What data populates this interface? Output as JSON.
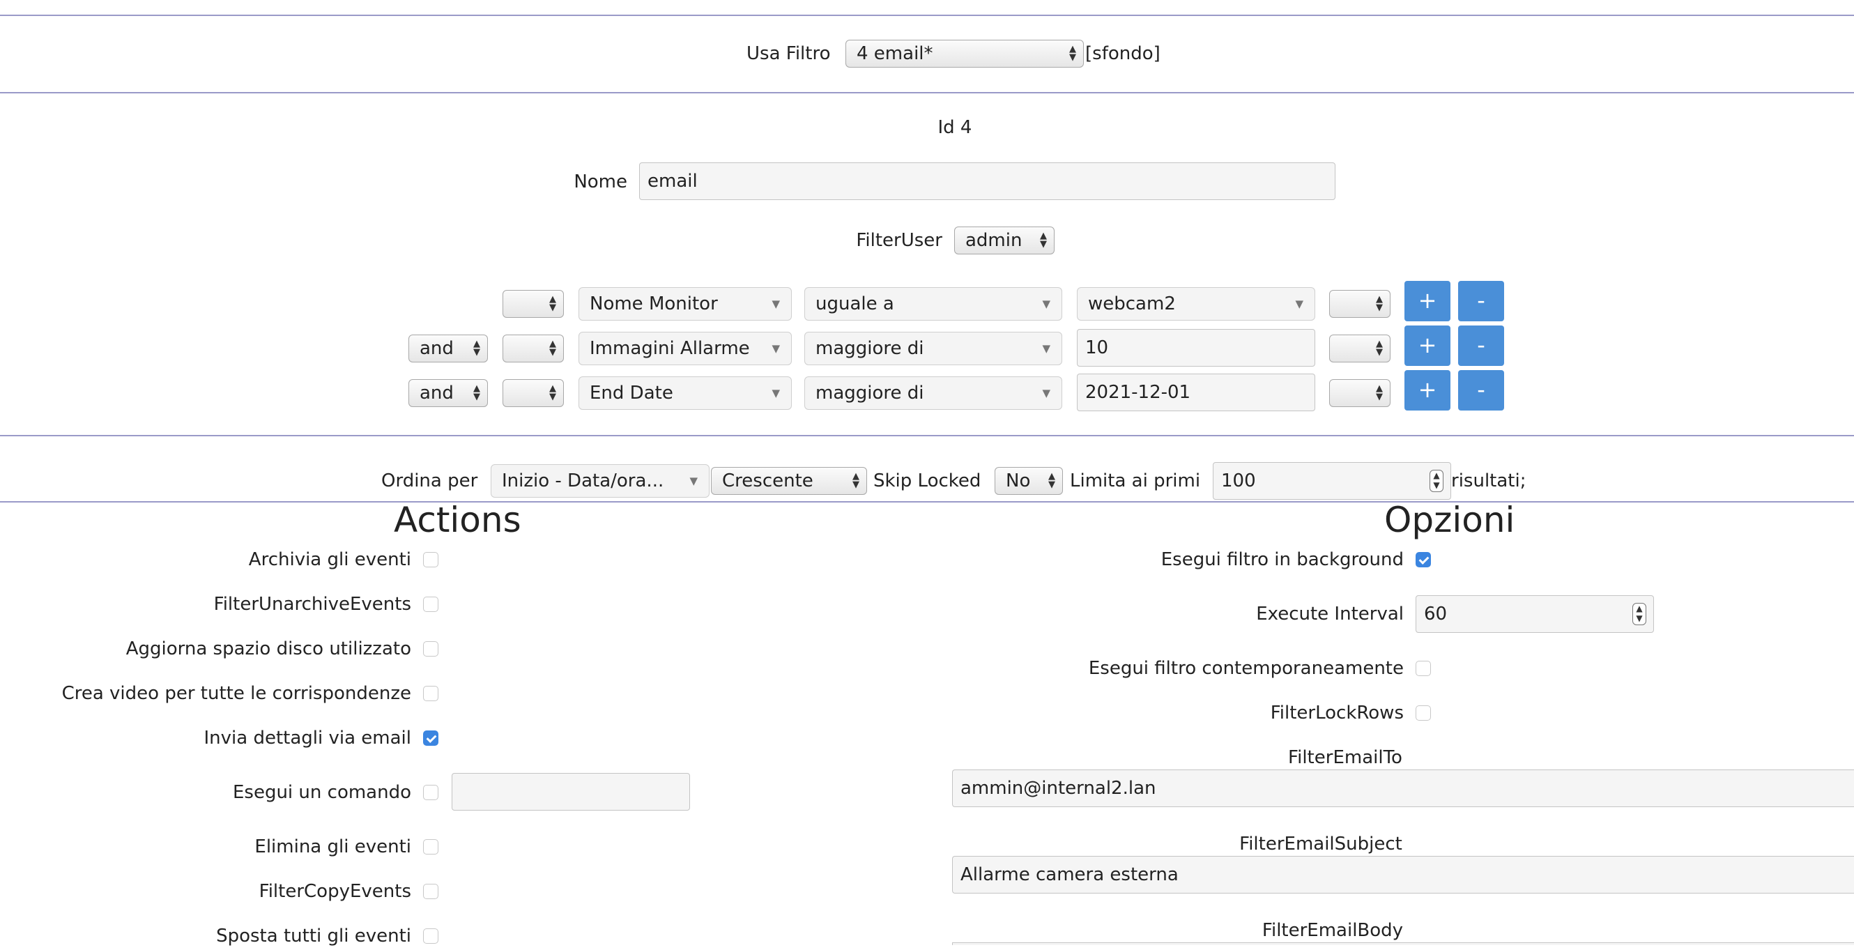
{
  "top": {
    "use_filter_label": "Usa Filtro",
    "filter_select": "4 email*",
    "background_tag": "[sfondo]"
  },
  "filter": {
    "id_label": "Id 4",
    "name_label": "Nome",
    "name_value": "email",
    "user_label": "FilterUser",
    "user_value": "admin",
    "terms": [
      {
        "conj": "",
        "open": "",
        "attr": "Nome Monitor",
        "op": "uguale a",
        "value": "webcam2",
        "close": ""
      },
      {
        "conj": "and",
        "open": "",
        "attr": "Immagini Allarme",
        "op": "maggiore di",
        "value": "10",
        "close": ""
      },
      {
        "conj": "and",
        "open": "",
        "attr": "End Date",
        "op": "maggiore di",
        "value": "2021-12-01",
        "close": ""
      }
    ],
    "add_label": "+",
    "remove_label": "-"
  },
  "sort": {
    "order_by_label": "Ordina per",
    "order_by_value": "Inizio - Data/ora...",
    "direction_value": "Crescente",
    "skip_locked_label": "Skip Locked",
    "skip_locked_value": "No",
    "limit_label": "Limita ai primi",
    "limit_value": "100",
    "results_label": "risultati;"
  },
  "actions": {
    "title": "Actions",
    "items": [
      {
        "label": "Archivia gli eventi",
        "checked": false
      },
      {
        "label": "FilterUnarchiveEvents",
        "checked": false
      },
      {
        "label": "Aggiorna spazio disco utilizzato",
        "checked": false
      },
      {
        "label": "Crea video per tutte le corrispondenze",
        "checked": false
      },
      {
        "label": "Invia dettagli via email",
        "checked": true
      },
      {
        "label": "Esegui un comando",
        "checked": false,
        "command_value": ""
      },
      {
        "label": "Elimina gli eventi",
        "checked": false
      },
      {
        "label": "FilterCopyEvents",
        "checked": false
      },
      {
        "label": "Sposta tutti gli eventi",
        "checked": false
      }
    ]
  },
  "options": {
    "title": "Opzioni",
    "background_label": "Esegui filtro in background",
    "background_checked": true,
    "interval_label": "Execute Interval",
    "interval_value": "60",
    "concurrent_label": "Esegui filtro contemporaneamente",
    "concurrent_checked": false,
    "lockrows_label": "FilterLockRows",
    "lockrows_checked": false,
    "email_to_label": "FilterEmailTo",
    "email_to_value": "ammin@internal2.lan",
    "email_subject_label": "FilterEmailSubject",
    "email_subject_value": "Allarme camera esterna",
    "email_body_label": "FilterEmailBody"
  },
  "colors": {
    "accent": "#4a8fd8",
    "divider": "#9a9ac8",
    "checkbox_on": "#3b85e0"
  }
}
